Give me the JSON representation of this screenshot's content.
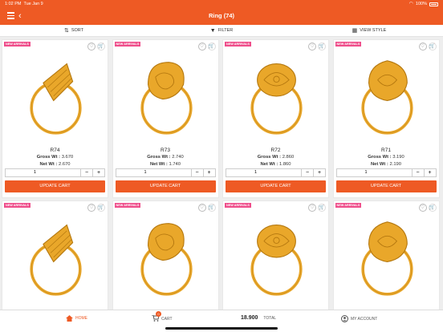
{
  "status_bar": {
    "time": "1:02 PM",
    "date": "Tue Jan 9",
    "battery": "100%"
  },
  "header": {
    "title": "Ring (74)"
  },
  "toolbar": {
    "sort": "SORT",
    "filter": "FILTER",
    "view_style": "VIEW STYLE"
  },
  "products": [
    {
      "badge": "NEW ARRIVALS",
      "name": "R74",
      "gross_label": "Gross Wt :",
      "gross": "3.670",
      "net_label": "Net Wt :",
      "net": "2.670",
      "qty": "1",
      "button": "UPDATE CART"
    },
    {
      "badge": "NEW ARRIVALS",
      "name": "R73",
      "gross_label": "Gross Wt :",
      "gross": "2.740",
      "net_label": "Net Wt :",
      "net": "1.740",
      "qty": "1",
      "button": "UPDATE CART"
    },
    {
      "badge": "NEW ARRIVALS",
      "name": "R72",
      "gross_label": "Gross Wt :",
      "gross": "2.860",
      "net_label": "Net Wt :",
      "net": "1.860",
      "qty": "1",
      "button": "UPDATE CART"
    },
    {
      "badge": "NEW ARRIVALS",
      "name": "R71",
      "gross_label": "Gross Wt :",
      "gross": "3.190",
      "net_label": "Net Wt :",
      "net": "2.190",
      "qty": "1",
      "button": "UPDATE CART"
    },
    {
      "badge": "NEW ARRIVALS"
    },
    {
      "badge": "NEW ARRIVALS"
    },
    {
      "badge": "NEW ARRIVALS"
    },
    {
      "badge": "NEW ARRIVALS"
    }
  ],
  "bottom_nav": {
    "home": "HOME",
    "cart": "CART",
    "cart_count": "0",
    "total_amount": "18.900",
    "total_label": "TOTAL",
    "account": "MY ACCOUNT"
  },
  "colors": {
    "accent": "#ee5a24",
    "badge": "#ef4d8a",
    "gold": "#e9a72a"
  },
  "icons": [
    "menu-icon",
    "back-icon",
    "sort-icon",
    "filter-icon",
    "view-style-icon",
    "heart-icon",
    "cart-icon",
    "home-icon",
    "account-icon"
  ]
}
